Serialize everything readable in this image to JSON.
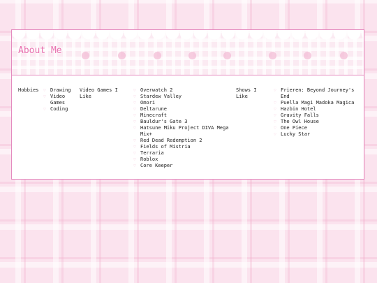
{
  "page": {
    "title": "About Me"
  },
  "sections": {
    "hobbies": {
      "label": "Hobbies",
      "items": [
        "Drawing",
        "Video Games",
        "Coding"
      ]
    },
    "games": {
      "label": "Video Games I Like",
      "items": [
        "Overwatch 2",
        "Stardew Valley",
        "Omori",
        "Deltarune",
        "Minecraft",
        "Bauldur's Gate 3",
        "Hatsune Miku Project DIVA Mega Mix+",
        "Red Dead Redemption 2",
        "Fields of Mistria",
        "Terraria",
        "Roblox",
        "Core Keeper"
      ]
    },
    "shows": {
      "label": "Shows I Like",
      "items": [
        "Frieren: Beyond Journey's End",
        "Puella Magi Madoka Magica",
        "Hazbin Hotel",
        "Gravity Falls",
        "The Owl House",
        "One Piece",
        "Lucky Star"
      ]
    }
  },
  "bullet_icon": "heart-icon",
  "colors": {
    "accent": "#e86fae",
    "border": "#e48bbf",
    "background": "#fbe3ee",
    "bullet": "#f0b8cf"
  }
}
